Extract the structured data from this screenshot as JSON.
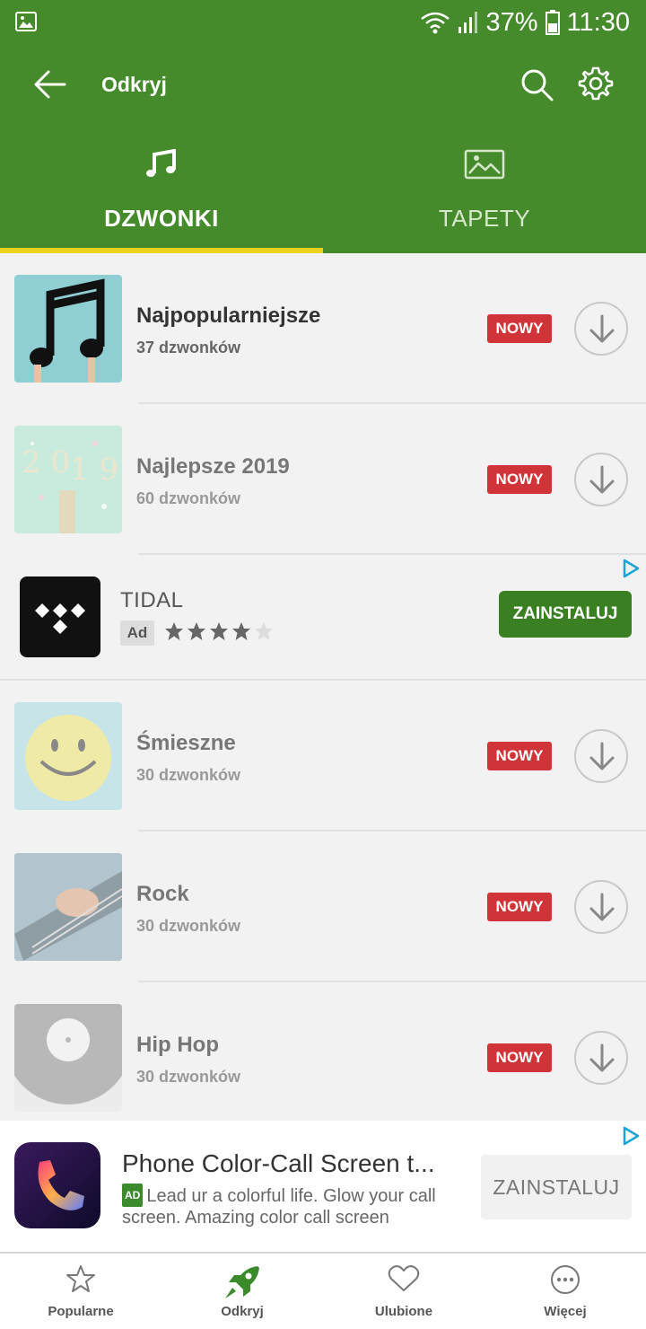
{
  "status_bar": {
    "battery": "37%",
    "time": "11:30"
  },
  "app_bar": {
    "title": "Odkryj"
  },
  "tabs": [
    {
      "label": "DZWONKI",
      "icon": "music-note-icon",
      "active": true
    },
    {
      "label": "TAPETY",
      "icon": "image-icon",
      "active": false
    }
  ],
  "categories": [
    {
      "name": "Najpopularniejsze",
      "count": "37 dzwonków",
      "badge": "NOWY"
    },
    {
      "name": "Najlepsze 2019",
      "count": "60 dzwonków",
      "badge": "NOWY"
    },
    {
      "name": "Śmieszne",
      "count": "30 dzwonków",
      "badge": "NOWY"
    },
    {
      "name": "Rock",
      "count": "30 dzwonków",
      "badge": "NOWY"
    },
    {
      "name": "Hip Hop",
      "count": "30 dzwonków",
      "badge": "NOWY"
    }
  ],
  "ad_row": {
    "app_name": "TIDAL",
    "ad_label": "Ad",
    "rating": 4,
    "rating_max": 5,
    "install_label": "ZAINSTALUJ"
  },
  "banner_ad": {
    "title": "Phone Color-Call Screen t...",
    "ad_badge": "AD",
    "description": "Lead ur a colorful life. Glow your call screen. Amazing color call screen",
    "install_label": "ZAINSTALUJ"
  },
  "bottom_nav": [
    {
      "label": "Popularne",
      "icon": "star-icon"
    },
    {
      "label": "Odkryj",
      "icon": "rocket-icon",
      "active": true
    },
    {
      "label": "Ulubione",
      "icon": "heart-icon"
    },
    {
      "label": "Więcej",
      "icon": "more-icon"
    }
  ],
  "colors": {
    "primary": "#458a2b",
    "indicator": "#e9d31f",
    "badge": "#d13438",
    "install": "#3b7f23"
  }
}
